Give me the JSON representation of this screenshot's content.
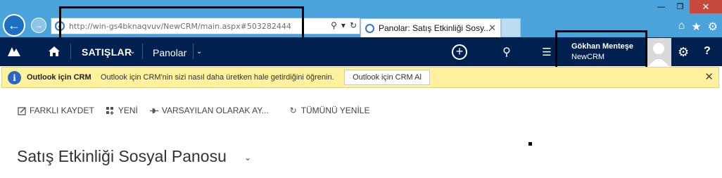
{
  "browser": {
    "address_host": "http://win-gs4bknaqvuv",
    "address_path": "/NewCRM/main.aspx#503282444",
    "tab_title": "Panolar: Satış Etkinliği Sosy...",
    "icons": {
      "back": "arrow-left-icon",
      "forward": "arrow-right-icon",
      "search": "search-icon",
      "refresh": "refresh-icon",
      "home": "home-icon",
      "favorites": "star-icon",
      "tools": "gear-icon"
    }
  },
  "crm_nav": {
    "area_label": "SATIŞLAR",
    "sub_label": "Panolar",
    "user_name": "Gökhan Menteşe",
    "org_name": "NewCRM",
    "nav_bg": "#002050"
  },
  "notification": {
    "title": "Outlook için CRM",
    "message": "Outlook için CRM'nin sizi nasıl daha üretken hale getirdiğini öğrenin.",
    "button_label": "Outlook için CRM Al",
    "bg": "#fff19d"
  },
  "command_bar": {
    "save_as": "FARKLI KAYDET",
    "new": "YENİ",
    "set_default": "VARSAYILAN OLARAK AY...",
    "refresh_all": "TÜMÜNÜ YENİLE"
  },
  "page": {
    "title": "Satış Etkinliği Sosyal Panosu"
  }
}
